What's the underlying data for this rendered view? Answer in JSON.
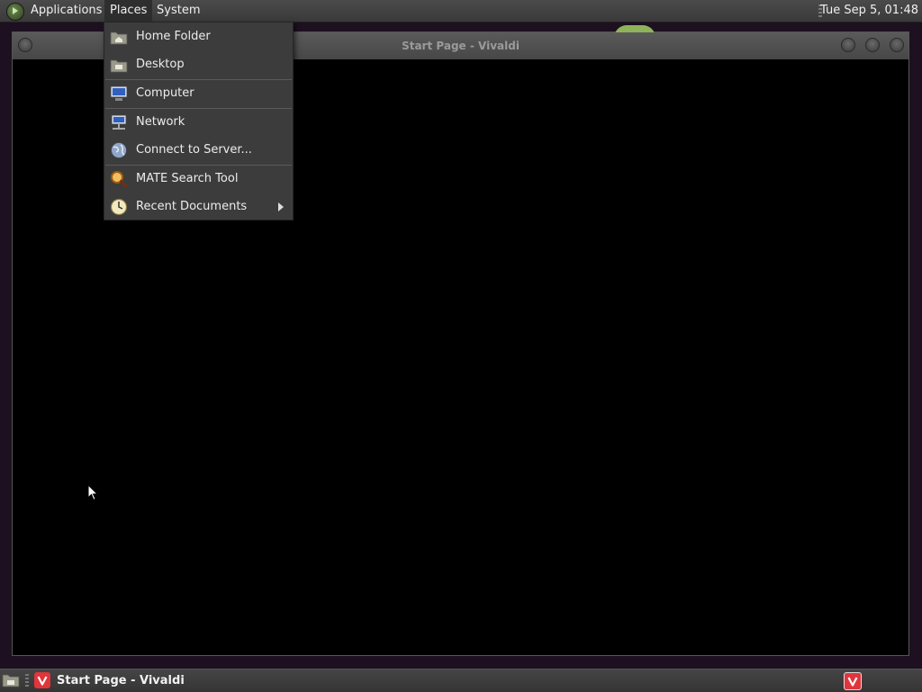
{
  "top_panel": {
    "menus": [
      "Applications",
      "Places",
      "System"
    ],
    "clock": "Tue Sep  5, 01:48"
  },
  "window": {
    "title": "Start Page - Vivaldi"
  },
  "places_menu": {
    "items": [
      {
        "label": "Home Folder",
        "icon": "home-folder-icon"
      },
      {
        "label": "Desktop",
        "icon": "desktop-folder-icon"
      },
      {
        "label": "Computer",
        "icon": "computer-icon"
      },
      {
        "label": "Network",
        "icon": "network-icon"
      },
      {
        "label": "Connect to Server...",
        "icon": "globe-icon"
      },
      {
        "label": "MATE Search Tool",
        "icon": "search-icon"
      },
      {
        "label": "Recent Documents",
        "icon": "clock-icon",
        "has_submenu": true
      }
    ]
  },
  "taskbar": {
    "tasks": [
      {
        "label": "Start Page - Vivaldi",
        "icon": "vivaldi-icon"
      }
    ]
  },
  "colors": {
    "desktop_bg": "#1d1020",
    "panel_bg": "#3a3a3a",
    "menu_bg": "#3c3c3c",
    "vivaldi_red": "#e0353b"
  }
}
